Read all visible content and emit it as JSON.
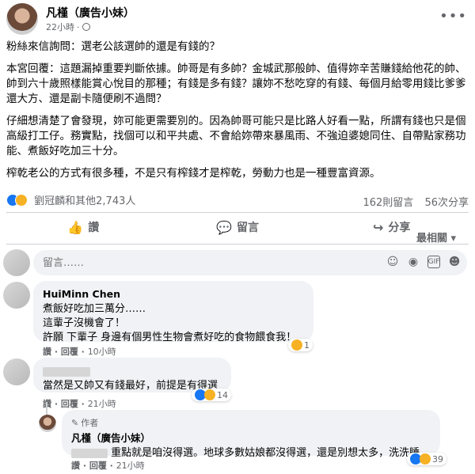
{
  "post": {
    "author": "凡槿（廣告小妹）",
    "time": "22小時",
    "more_icon": "more-horizontal-icon",
    "paragraphs": [
      "粉絲來信詢問：選老公該選帥的還是有錢的？",
      "本宮回覆：這題漏掉重要判斷依據。帥哥是有多帥？金城武那般帥、值得妳辛苦賺錢給他花的帥、帥到六十歲照樣能賞心悅目的那種；有錢是多有錢？讓妳不愁吃穿的有錢、每個月給零用錢比爹爹還大方、還是副卡隨便刷不過問？",
      "仔細想清楚了會發現，妳可能更需要別的。因為帥哥可能只是比路人好看一點，所謂有錢也只是個高級打工仔。務實點，找個可以和平共處、不會給妳帶來暴風雨、不強迫婆媳同住、自帶點家務功能、煮飯好吃加三十分。",
      "榨乾老公的方式有很多種，不是只有榨錢才是榨乾，勞動力也是一種豐富資源。"
    ]
  },
  "stats": {
    "reactions_text": "劉冠麟和其他2,743人",
    "comments": "162則留言",
    "shares": "56次分享"
  },
  "actions": {
    "like": "讚",
    "comment": "留言",
    "share": "分享"
  },
  "sort_label": "最相關 ▾",
  "comment_box": {
    "placeholder": "留言……"
  },
  "comments": [
    {
      "name": "HuiMinn Chen",
      "lines": [
        "煮飯好吃加三萬分……",
        "這輩子沒機會了！",
        "許願 下輩子 身邊有個男性生物會煮好吃的食物餵食我！"
      ],
      "like": "讚",
      "reply": "回覆",
      "time": "10小時",
      "reactions": "1"
    },
    {
      "name": "",
      "lines": [
        "當然是又帥又有錢最好，前提是有得選"
      ],
      "like": "讚",
      "reply": "回覆",
      "time": "21小時",
      "reactions": "14"
    }
  ],
  "reply": {
    "badge": "作者",
    "name": "凡槿（廣告小妹）",
    "text": "重點就是咱沒得選。地球多數姑娘都沒得選，還是別想太多，洗洗睡。",
    "like": "讚",
    "reply": "回覆",
    "time": "21小時",
    "reactions": "39"
  }
}
